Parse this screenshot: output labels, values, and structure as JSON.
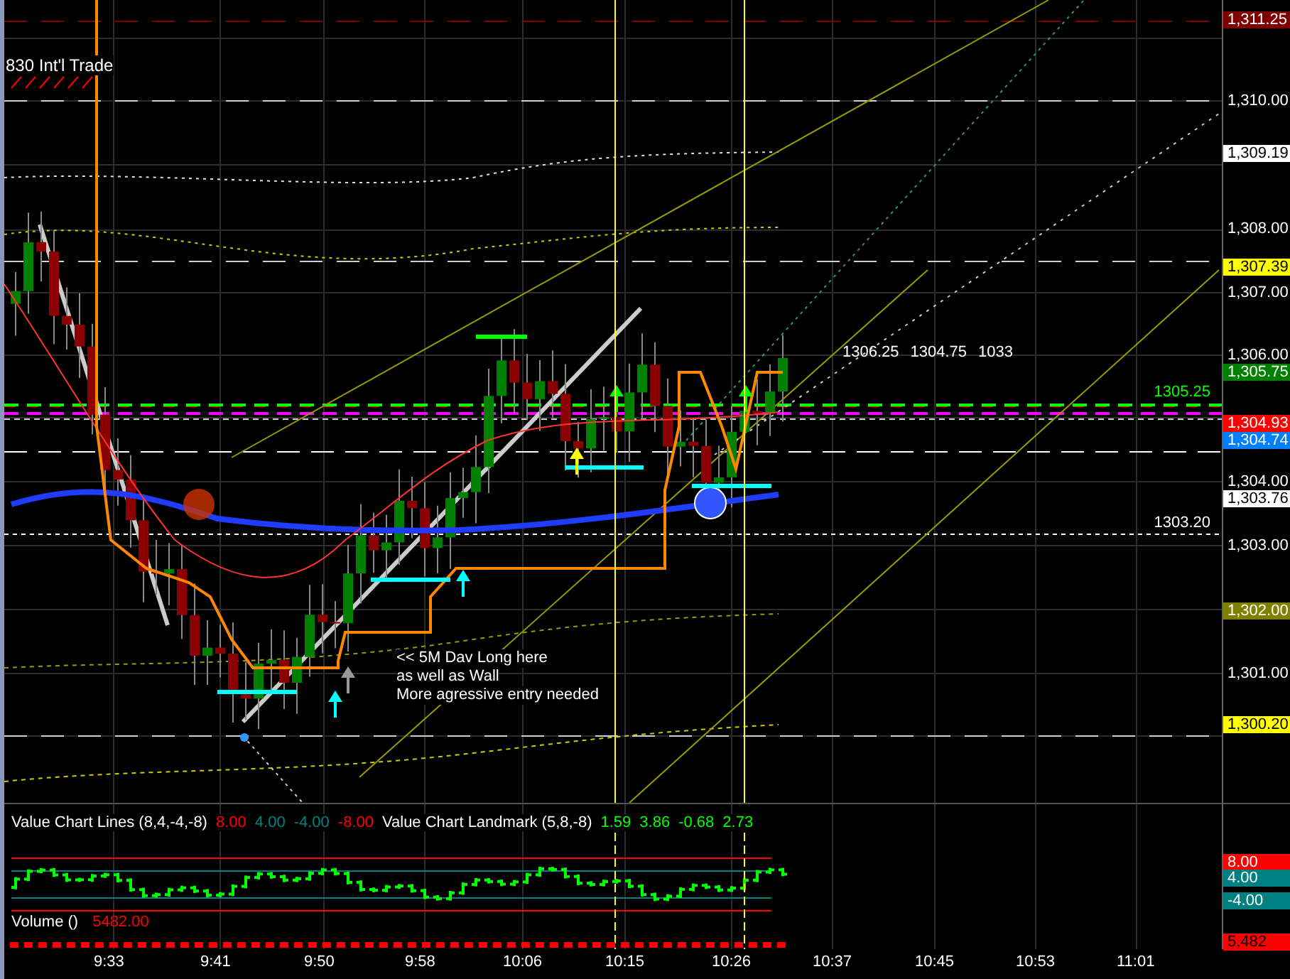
{
  "price_panel": {
    "study_label": "830 Int'l Trade",
    "quote": [
      "1306.25",
      "1304.75",
      "1033"
    ],
    "level_labels": [
      {
        "text": "1305.25",
        "color": "#00ff00"
      },
      {
        "text": "1303.20",
        "color": "#ffffff"
      }
    ],
    "note": [
      "<< 5M Dav Long here",
      "as well as Wall",
      "More agressive entry needed"
    ]
  },
  "price_axis": {
    "ticks": [
      "1,310.00",
      "1,308.00",
      "1,307.00",
      "1,306.00",
      "1,304.00",
      "1,303.00",
      "1,301.00"
    ],
    "tags": [
      {
        "text": "1,311.25",
        "color": "#800000"
      },
      {
        "text": "1,309.19",
        "color": "#ffffff"
      },
      {
        "text": "1,307.39",
        "color": "#ffff00"
      },
      {
        "text": "1,305.75",
        "color": "#008000"
      },
      {
        "text": "1,304.93",
        "color": "#ff0000"
      },
      {
        "text": "1,304.74",
        "color": "#0080ff"
      },
      {
        "text": "1,303.76",
        "color": "#ffffff"
      },
      {
        "text": "1,302.00",
        "color": "#808000"
      },
      {
        "text": "1,300.20",
        "color": "#ffff00"
      }
    ]
  },
  "value_chart": {
    "lines_label": "Value Chart Lines (8,4,-4,-8)",
    "lines_values": [
      {
        "text": "8.00",
        "color": "#ff0000"
      },
      {
        "text": "4.00",
        "color": "#008080"
      },
      {
        "text": "-4.00",
        "color": "#008080"
      },
      {
        "text": "-8.00",
        "color": "#ff0000"
      }
    ],
    "landmark_label": "Value Chart Landmark (5,8,-8)",
    "landmark_values": [
      "1.59",
      "3.86",
      "-0.68",
      "2.73"
    ],
    "axis_tags": [
      {
        "text": "8.00",
        "color": "#ff0000"
      },
      {
        "text": "4.00",
        "color": "#008080"
      },
      {
        "text": "-4.00",
        "color": "#008080"
      }
    ]
  },
  "volume": {
    "label": "Volume ()",
    "value": "5482.00",
    "axis_tag": "5,482"
  },
  "time_axis": {
    "labels": [
      "9:33",
      "9:41",
      "9:50",
      "9:58",
      "10:06",
      "10:15",
      "10:26",
      "10:37",
      "10:45",
      "10:53",
      "11:01"
    ]
  }
}
